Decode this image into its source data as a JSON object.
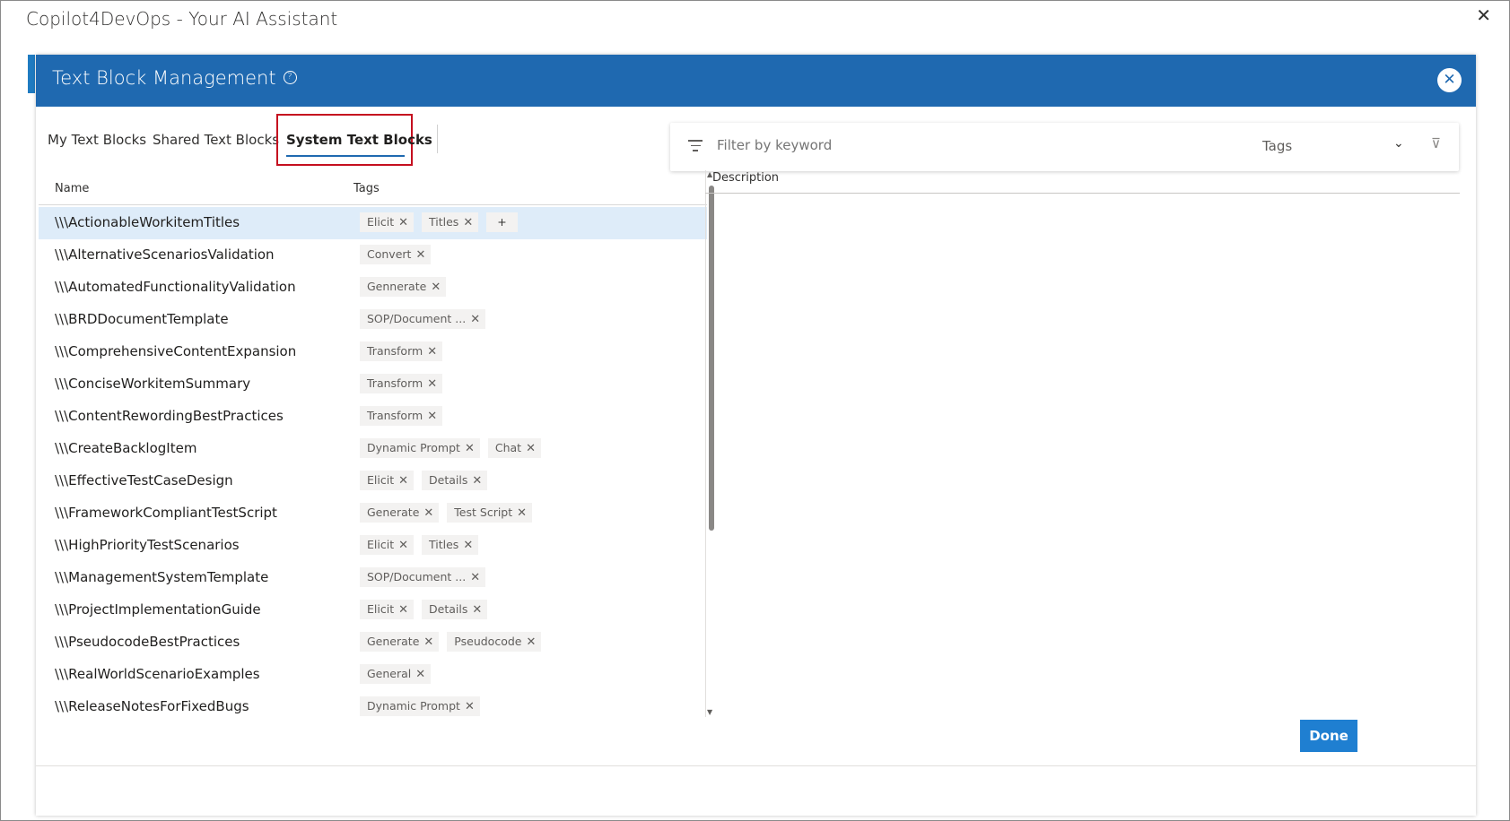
{
  "window": {
    "title": "Copilot4DevOps - Your AI Assistant",
    "close_glyph": "✕"
  },
  "dialog": {
    "title": "Text Block Management",
    "help_glyph": "?",
    "close_glyph": "✕"
  },
  "tabs": [
    {
      "label": "My Text Blocks"
    },
    {
      "label": "Shared Text Blocks"
    },
    {
      "label": "System Text Blocks",
      "active": true
    }
  ],
  "filter": {
    "placeholder": "Filter by keyword",
    "tags_label": "Tags",
    "chevron": "⌄",
    "clear_icon": "⊽"
  },
  "grid": {
    "headers": {
      "name": "Name",
      "tags": "Tags"
    },
    "rows": [
      {
        "name": "\\\\\\ActionableWorkitemTitles",
        "tags": [
          "Elicit",
          "Titles"
        ],
        "selected": true
      },
      {
        "name": "\\\\\\AlternativeScenariosValidation",
        "tags": [
          "Convert"
        ]
      },
      {
        "name": "\\\\\\AutomatedFunctionalityValidation",
        "tags": [
          "Gennerate"
        ]
      },
      {
        "name": "\\\\\\BRDDocumentTemplate",
        "tags": [
          "SOP/Document ..."
        ]
      },
      {
        "name": "\\\\\\ComprehensiveContentExpansion",
        "tags": [
          "Transform"
        ]
      },
      {
        "name": "\\\\\\ConciseWorkitemSummary",
        "tags": [
          "Transform"
        ]
      },
      {
        "name": "\\\\\\ContentRewordingBestPractices",
        "tags": [
          "Transform"
        ]
      },
      {
        "name": "\\\\\\CreateBacklogItem",
        "tags": [
          "Dynamic Prompt",
          "Chat"
        ]
      },
      {
        "name": "\\\\\\EffectiveTestCaseDesign",
        "tags": [
          "Elicit",
          "Details"
        ]
      },
      {
        "name": "\\\\\\FrameworkCompliantTestScript",
        "tags": [
          "Generate",
          "Test Script"
        ]
      },
      {
        "name": "\\\\\\HighPriorityTestScenarios",
        "tags": [
          "Elicit",
          "Titles"
        ]
      },
      {
        "name": "\\\\\\ManagementSystemTemplate",
        "tags": [
          "SOP/Document ..."
        ]
      },
      {
        "name": "\\\\\\ProjectImplementationGuide",
        "tags": [
          "Elicit",
          "Details"
        ]
      },
      {
        "name": "\\\\\\PseudocodeBestPractices",
        "tags": [
          "Generate",
          "Pseudocode"
        ]
      },
      {
        "name": "\\\\\\RealWorldScenarioExamples",
        "tags": [
          "General"
        ]
      },
      {
        "name": "\\\\\\ReleaseNotesForFixedBugs",
        "tags": [
          "Dynamic Prompt"
        ]
      }
    ],
    "add_tag_label": "+",
    "remove_glyph": "✕"
  },
  "description": {
    "header": "Description"
  },
  "footer": {
    "done_label": "Done"
  },
  "colors": {
    "header_blue": "#1f69b0",
    "done_blue": "#1f7fd1",
    "selected_row": "#deecf9",
    "highlight_red": "#c50f1f"
  }
}
